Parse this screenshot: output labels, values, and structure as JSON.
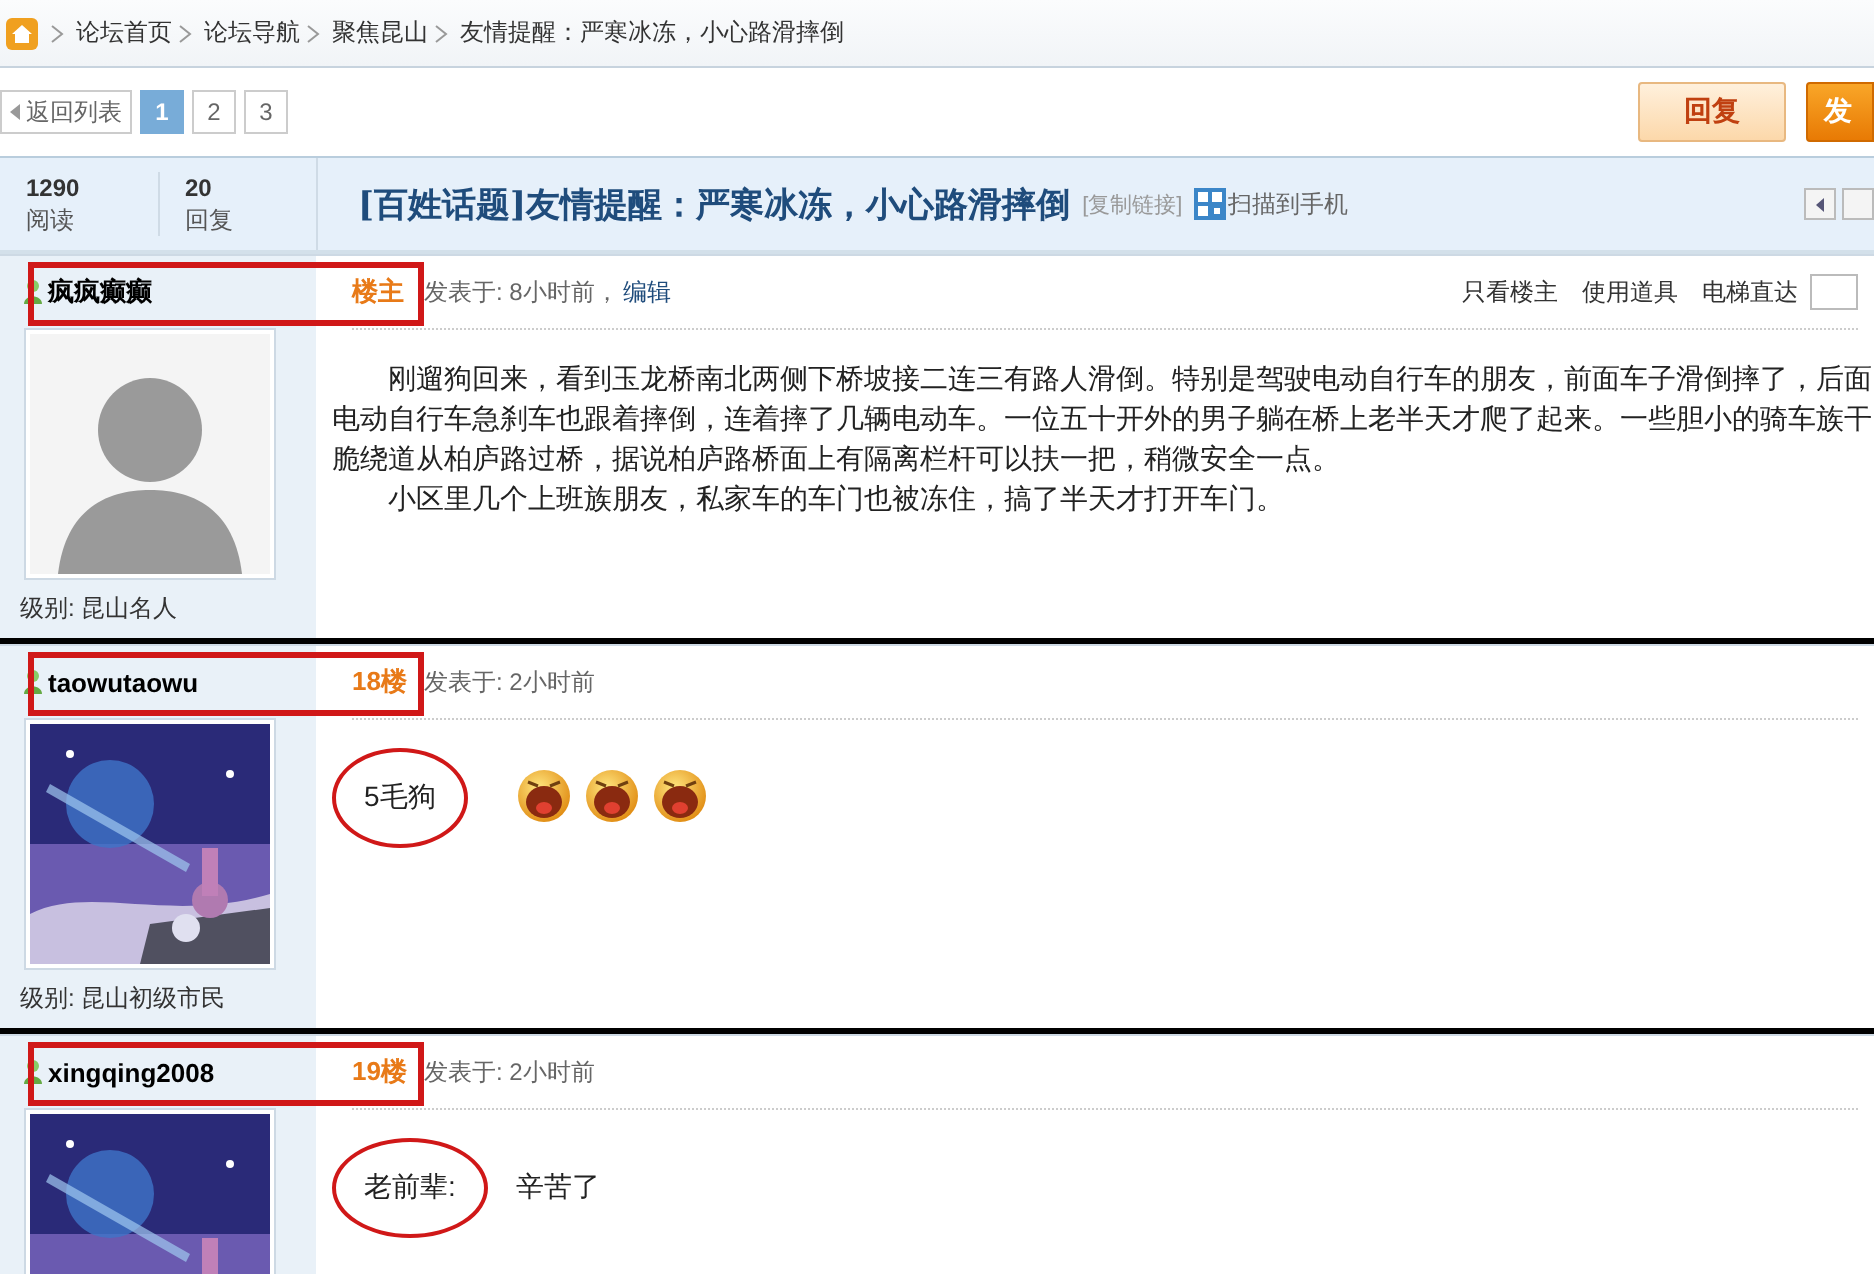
{
  "breadcrumb": [
    "论坛首页",
    "论坛导航",
    "聚焦昆山",
    "友情提醒：严寒冰冻，小心路滑摔倒"
  ],
  "pager": {
    "back": "返回列表",
    "pages": [
      {
        "label": "1",
        "selected": true
      },
      {
        "label": "2",
        "selected": false
      },
      {
        "label": "3",
        "selected": false
      }
    ]
  },
  "actions": [
    {
      "label": "回复",
      "kind": "reply"
    },
    {
      "label": "发",
      "kind": "post"
    }
  ],
  "thread": {
    "views": "1290",
    "views_label": "阅读",
    "replies": "20",
    "replies_label": "回复",
    "title": "[百姓话题]友情提醒：严寒冰冻，小心路滑摔倒",
    "copy_link": "[复制链接]",
    "scan": "扫描到手机"
  },
  "posts": [
    {
      "author": "疯疯癫癫",
      "floor": "楼主",
      "posted": "发表于: 8小时前，",
      "edit": "编辑",
      "tools": [
        "只看楼主",
        "使用道具",
        "电梯直达"
      ],
      "avatar": {
        "kind": "portrait"
      },
      "level": "级别: 昆山名人",
      "highlighted": true,
      "marked_divider": true,
      "lines": [
        {
          "text": "刚遛狗回来，看到玉龙桥南北两侧下桥坡接二连三有路人滑倒。特别是驾驶电动自行车的朋友，前面车子滑倒摔了，后面",
          "indent": true
        },
        {
          "text": "电动自行车急刹车也跟着摔倒，连着摔了几辆电动车。一位五十开外的男子躺在桥上老半天才爬了起来。一些胆小的骑车族干",
          "indent": false
        },
        {
          "text": "脆绕道从柏庐路过桥，据说柏庐路桥面上有隔离栏杆可以扶一把，稍微安全一点。",
          "indent": false
        },
        {
          "text": "小区里几个上班族朋友，私家车的车门也被冻住，搞了半天才打开车门。",
          "indent": true
        }
      ]
    },
    {
      "author": "taowutaowu",
      "floor": "18楼",
      "posted": "发表于: 2小时前",
      "avatar": {
        "kind": "picture"
      },
      "level": "级别: 昆山初级市民",
      "highlighted": true,
      "marked_divider": true,
      "segments": [
        {
          "text": "5毛狗",
          "circled": true
        }
      ],
      "emoticons": [
        {
          "kind": "laugh"
        },
        {
          "kind": "laugh"
        },
        {
          "kind": "laugh"
        }
      ]
    },
    {
      "author": "xingqing2008",
      "floor": "19楼",
      "posted": "发表于: 2小时前",
      "avatar": {
        "kind": "picture"
      },
      "highlighted": true,
      "marked_divider": false,
      "segments": [
        {
          "text": "老前辈:",
          "circled": true
        },
        {
          "text": "辛苦了",
          "circled": false
        }
      ]
    }
  ]
}
